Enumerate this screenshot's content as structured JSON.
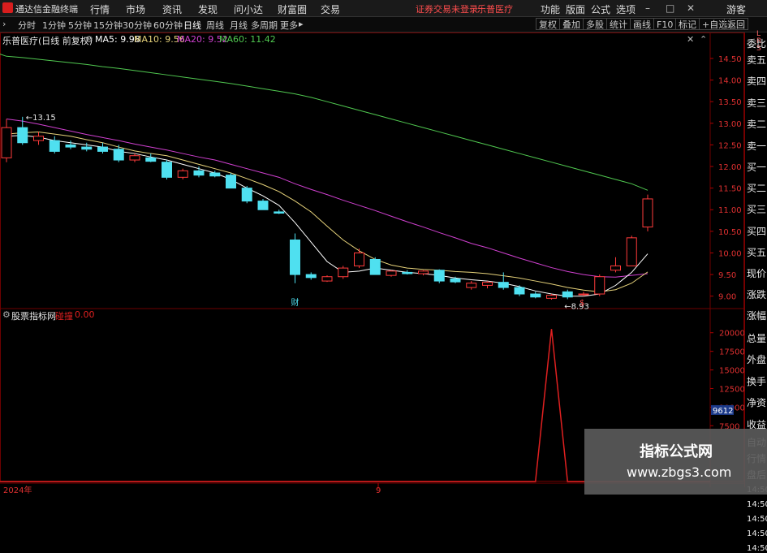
{
  "app": {
    "title": "通达信金融终端"
  },
  "menu": [
    "行情",
    "市场",
    "资讯",
    "发现",
    "问小达",
    "财富圈",
    "交易"
  ],
  "alert_text": "证券交易未登录",
  "stock_name_menu": "乐普医疗",
  "menu_right": [
    "功能",
    "版面",
    "公式",
    "选项"
  ],
  "guest": "游客",
  "periods": [
    "分时",
    "1分钟",
    "5分钟",
    "15分钟",
    "30分钟",
    "60分钟",
    "日线",
    "周线",
    "月线",
    "多周期",
    "更多"
  ],
  "active_period": "日线",
  "toolbar_buttons": [
    "复权",
    "叠加",
    "多股",
    "统计",
    "画线",
    "F10",
    "标记",
    "+自选",
    "返回"
  ],
  "chart_title": "乐普医疗(日线 前复权)",
  "ma_labels": [
    {
      "text": "MA5: 9.98",
      "color": "#ffffff"
    },
    {
      "text": "MA10: 9.56",
      "color": "#e6d27a"
    },
    {
      "text": "MA20: 9.52",
      "color": "#d040d0"
    },
    {
      "text": "MA60: 11.42",
      "color": "#50c850"
    }
  ],
  "indicator": {
    "name": "股票指标网",
    "label": "碰撞",
    "value": "0.00"
  },
  "side_top": [
    "L",
    "R",
    "S"
  ],
  "side_panel": [
    "委比",
    "卖五",
    "卖四",
    "卖三",
    "卖二",
    "卖一",
    "买一",
    "买二",
    "买三",
    "买四",
    "买五",
    "现价",
    "涨跌",
    "涨幅",
    "总量",
    "外盘",
    "换手",
    "净资",
    "收益",
    "自动",
    "行情",
    "盘后",
    "14:50",
    "14:50",
    "14:50",
    "14:50",
    "14:50",
    "14:50",
    "14:50"
  ],
  "colors": {
    "up": "#ff3b3b",
    "down": "#4fe0f0",
    "grid": "#6e0000",
    "ma5": "#ffffff",
    "ma10": "#e6d27a",
    "ma20": "#d040d0",
    "ma60": "#50c850",
    "indicator": "#e02020"
  },
  "chart_data": {
    "type": "candlestick",
    "x_labels": [
      "2024年",
      "9"
    ],
    "price_axis": [
      14.5,
      14.0,
      13.5,
      13.0,
      12.5,
      12.0,
      11.5,
      11.0,
      10.5,
      10.0,
      9.5,
      9.0
    ],
    "ylim": [
      8.75,
      14.8
    ],
    "candles": [
      {
        "o": 12.2,
        "h": 13.1,
        "l": 12.1,
        "c": 12.9
      },
      {
        "o": 12.9,
        "h": 13.15,
        "l": 12.5,
        "c": 12.55
      },
      {
        "o": 12.6,
        "h": 12.8,
        "l": 12.5,
        "c": 12.7
      },
      {
        "o": 12.6,
        "h": 12.7,
        "l": 12.3,
        "c": 12.35
      },
      {
        "o": 12.5,
        "h": 12.6,
        "l": 12.4,
        "c": 12.45
      },
      {
        "o": 12.45,
        "h": 12.55,
        "l": 12.35,
        "c": 12.4
      },
      {
        "o": 12.45,
        "h": 12.55,
        "l": 12.3,
        "c": 12.35
      },
      {
        "o": 12.4,
        "h": 12.5,
        "l": 12.1,
        "c": 12.15
      },
      {
        "o": 12.15,
        "h": 12.3,
        "l": 12.1,
        "c": 12.25
      },
      {
        "o": 12.2,
        "h": 12.3,
        "l": 12.1,
        "c": 12.12
      },
      {
        "o": 12.1,
        "h": 12.15,
        "l": 11.7,
        "c": 11.75
      },
      {
        "o": 11.75,
        "h": 11.95,
        "l": 11.7,
        "c": 11.9
      },
      {
        "o": 11.9,
        "h": 12.0,
        "l": 11.75,
        "c": 11.8
      },
      {
        "o": 11.85,
        "h": 11.9,
        "l": 11.75,
        "c": 11.78
      },
      {
        "o": 11.8,
        "h": 11.85,
        "l": 11.5,
        "c": 11.5
      },
      {
        "o": 11.5,
        "h": 11.55,
        "l": 11.15,
        "c": 11.2
      },
      {
        "o": 11.2,
        "h": 11.25,
        "l": 11.0,
        "c": 11.0
      },
      {
        "o": 10.95,
        "h": 11.0,
        "l": 10.9,
        "c": 10.92
      },
      {
        "o": 10.3,
        "h": 10.45,
        "l": 9.3,
        "c": 9.5
      },
      {
        "o": 9.5,
        "h": 9.55,
        "l": 9.38,
        "c": 9.43
      },
      {
        "o": 9.35,
        "h": 9.48,
        "l": 9.33,
        "c": 9.45
      },
      {
        "o": 9.45,
        "h": 9.7,
        "l": 9.4,
        "c": 9.65
      },
      {
        "o": 9.7,
        "h": 10.1,
        "l": 9.65,
        "c": 10.0
      },
      {
        "o": 9.85,
        "h": 9.9,
        "l": 9.5,
        "c": 9.5
      },
      {
        "o": 9.48,
        "h": 9.6,
        "l": 9.45,
        "c": 9.58
      },
      {
        "o": 9.55,
        "h": 9.6,
        "l": 9.5,
        "c": 9.52
      },
      {
        "o": 9.52,
        "h": 9.6,
        "l": 9.48,
        "c": 9.58
      },
      {
        "o": 9.6,
        "h": 9.62,
        "l": 9.3,
        "c": 9.35
      },
      {
        "o": 9.4,
        "h": 9.45,
        "l": 9.3,
        "c": 9.33
      },
      {
        "o": 9.2,
        "h": 9.35,
        "l": 9.15,
        "c": 9.3
      },
      {
        "o": 9.25,
        "h": 9.35,
        "l": 9.18,
        "c": 9.32
      },
      {
        "o": 9.32,
        "h": 9.55,
        "l": 9.15,
        "c": 9.2
      },
      {
        "o": 9.2,
        "h": 9.25,
        "l": 9.0,
        "c": 9.05
      },
      {
        "o": 9.05,
        "h": 9.1,
        "l": 8.95,
        "c": 8.98
      },
      {
        "o": 8.95,
        "h": 9.05,
        "l": 8.92,
        "c": 9.02
      },
      {
        "o": 9.1,
        "h": 9.15,
        "l": 8.93,
        "c": 8.98
      },
      {
        "o": 9.05,
        "h": 9.1,
        "l": 9.0,
        "c": 9.05
      },
      {
        "o": 9.05,
        "h": 9.5,
        "l": 9.0,
        "c": 9.45
      },
      {
        "o": 9.6,
        "h": 9.9,
        "l": 9.55,
        "c": 9.7
      },
      {
        "o": 9.7,
        "h": 10.4,
        "l": 9.7,
        "c": 10.35
      },
      {
        "o": 10.6,
        "h": 11.35,
        "l": 10.5,
        "c": 11.25
      }
    ],
    "ma60": [
      14.55,
      14.52,
      14.48,
      14.44,
      14.4,
      14.36,
      14.31,
      14.27,
      14.22,
      14.17,
      14.12,
      14.07,
      14.02,
      13.97,
      13.92,
      13.86,
      13.8,
      13.74,
      13.68,
      13.6,
      13.5,
      13.4,
      13.3,
      13.2,
      13.1,
      13.0,
      12.9,
      12.8,
      12.7,
      12.6,
      12.5,
      12.4,
      12.3,
      12.2,
      12.1,
      12.0,
      11.9,
      11.8,
      11.7,
      11.6,
      11.45
    ],
    "ma20": [
      13.1,
      13.05,
      12.98,
      12.9,
      12.82,
      12.74,
      12.67,
      12.6,
      12.52,
      12.45,
      12.38,
      12.3,
      12.22,
      12.15,
      12.05,
      11.95,
      11.85,
      11.75,
      11.6,
      11.47,
      11.35,
      11.22,
      11.1,
      10.98,
      10.85,
      10.72,
      10.6,
      10.47,
      10.35,
      10.22,
      10.12,
      10.0,
      9.88,
      9.77,
      9.66,
      9.57,
      9.5,
      9.45,
      9.44,
      9.48,
      9.52
    ],
    "ma10": [
      12.75,
      12.78,
      12.8,
      12.75,
      12.7,
      12.62,
      12.55,
      12.45,
      12.36,
      12.3,
      12.25,
      12.15,
      12.05,
      11.95,
      11.85,
      11.72,
      11.58,
      11.42,
      11.2,
      10.95,
      10.62,
      10.3,
      10.05,
      9.85,
      9.72,
      9.65,
      9.62,
      9.6,
      9.57,
      9.55,
      9.52,
      9.47,
      9.42,
      9.35,
      9.28,
      9.2,
      9.14,
      9.1,
      9.15,
      9.3,
      9.56
    ],
    "ma5": [
      12.7,
      12.72,
      12.68,
      12.6,
      12.55,
      12.5,
      12.45,
      12.35,
      12.3,
      12.22,
      12.15,
      12.05,
      11.95,
      11.85,
      11.7,
      11.5,
      11.32,
      11.1,
      10.7,
      10.25,
      9.8,
      9.55,
      9.58,
      9.65,
      9.6,
      9.55,
      9.52,
      9.48,
      9.42,
      9.38,
      9.35,
      9.3,
      9.22,
      9.12,
      9.05,
      9.0,
      9.0,
      9.05,
      9.25,
      9.55,
      9.98
    ],
    "annotations": [
      {
        "text": "13.15",
        "candle": 1,
        "price": 13.15,
        "pos": "high"
      },
      {
        "text": "8.93",
        "candle": 35,
        "price": 8.93,
        "pos": "low"
      }
    ],
    "markers": [
      {
        "text": "财",
        "candle": 18,
        "color": "#4fe0f0"
      },
      {
        "text": "$",
        "candle": 36,
        "color": "#ff4d4d"
      }
    ],
    "indicator_axis": [
      20000,
      17500,
      15000,
      12500,
      10000,
      7500
    ],
    "indicator_current": "9612",
    "indicator_ylim": [
      0,
      21500
    ],
    "indicator_values": [
      0,
      0,
      0,
      0,
      0,
      0,
      0,
      0,
      0,
      0,
      0,
      0,
      0,
      0,
      0,
      0,
      0,
      0,
      0,
      0,
      0,
      0,
      0,
      0,
      0,
      0,
      0,
      0,
      0,
      0,
      0,
      0,
      0,
      0,
      20500,
      0,
      0,
      0,
      0,
      0,
      0
    ]
  }
}
